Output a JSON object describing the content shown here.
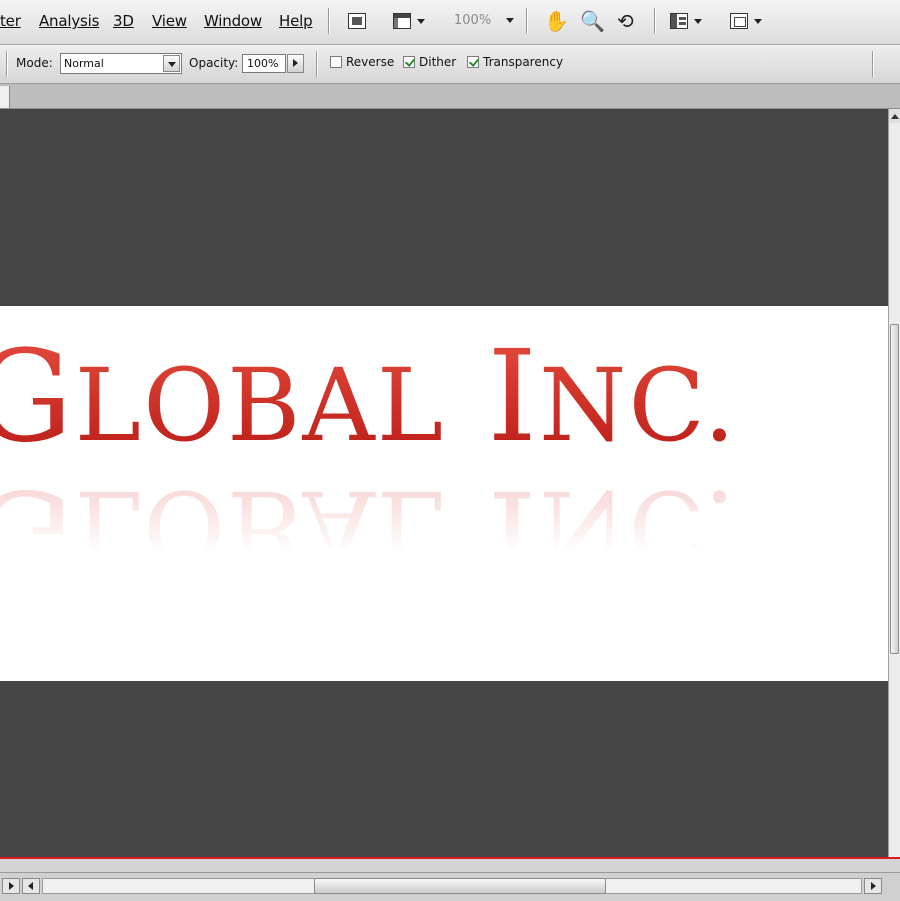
{
  "menubar": {
    "items": [
      "ter",
      "Analysis",
      "3D",
      "View",
      "Window",
      "Help"
    ],
    "zoom": "100%",
    "icons": [
      "bridge-icon",
      "screen-mode-icon",
      "hand-tool-icon",
      "zoom-tool-icon",
      "rotate-view-icon",
      "arrange-documents-icon",
      "screen-mode-menu-icon"
    ]
  },
  "options": {
    "mode_label": "Mode:",
    "mode_value": "Normal",
    "opacity_label": "Opacity:",
    "opacity_value": "100%",
    "reverse_label": "Reverse",
    "reverse_checked": false,
    "dither_label": "Dither",
    "dither_checked": true,
    "transparency_label": "Transparency",
    "transparency_checked": true
  },
  "document": {
    "logo_text": "Global Inc.",
    "logo_color": "#cc2a22",
    "canvas_bg": "#454545",
    "guide_color": "#e01a1a"
  }
}
